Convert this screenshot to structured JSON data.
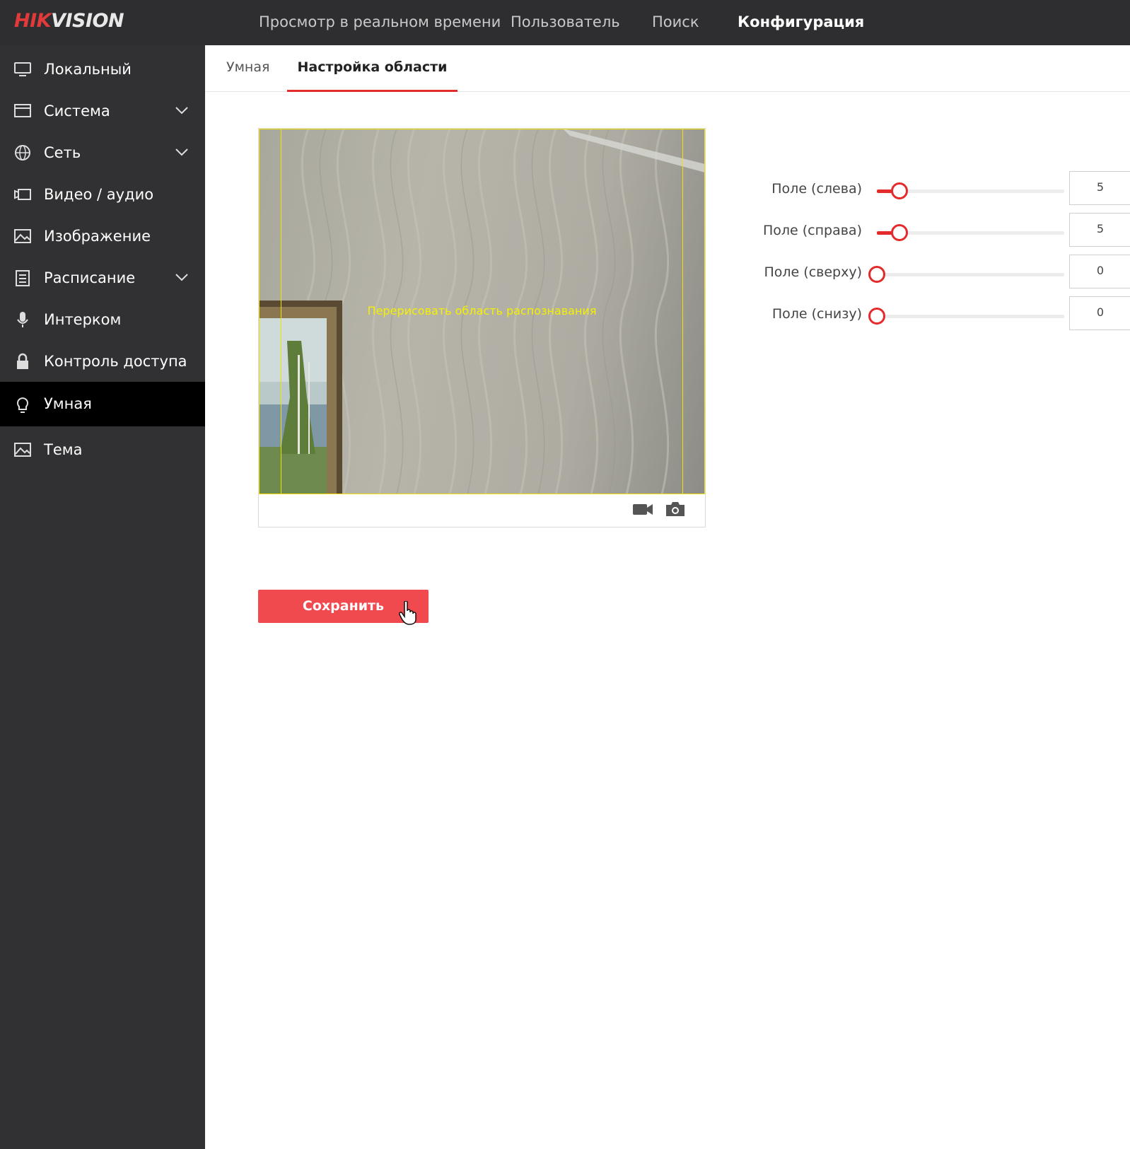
{
  "brand": {
    "part1": "HIK",
    "part2": "VISION"
  },
  "header": {
    "nav": [
      {
        "label": "Просмотр в реальном времени",
        "active": false
      },
      {
        "label": "Пользователь",
        "active": false
      },
      {
        "label": "Поиск",
        "active": false
      },
      {
        "label": "Конфигурация",
        "active": true
      }
    ]
  },
  "sidebar": {
    "items": [
      {
        "label": "Локальный",
        "icon": "monitor-icon",
        "expandable": false
      },
      {
        "label": "Система",
        "icon": "window-icon",
        "expandable": true
      },
      {
        "label": "Сеть",
        "icon": "globe-icon",
        "expandable": true
      },
      {
        "label": "Видео / аудио",
        "icon": "video-icon",
        "expandable": false
      },
      {
        "label": "Изображение",
        "icon": "image-icon",
        "expandable": false
      },
      {
        "label": "Расписание",
        "icon": "schedule-icon",
        "expandable": true
      },
      {
        "label": "Интерком",
        "icon": "microphone-icon",
        "expandable": false
      },
      {
        "label": "Контроль доступа",
        "icon": "lock-icon",
        "expandable": false
      },
      {
        "label": "Умная",
        "icon": "bulb-icon",
        "expandable": false,
        "active": true
      },
      {
        "label": "Тема",
        "icon": "theme-icon",
        "expandable": false
      }
    ]
  },
  "tabs": [
    {
      "label": "Умная",
      "active": false
    },
    {
      "label": "Настройка области",
      "active": true
    }
  ],
  "preview": {
    "overlay_text": "Перерисовать область распознавания"
  },
  "fields": [
    {
      "label": "Поле (слева)",
      "value": "5",
      "fraction": 0.05
    },
    {
      "label": "Поле (справа)",
      "value": "5",
      "fraction": 0.05
    },
    {
      "label": "Поле (сверху)",
      "value": "0",
      "fraction": 0.0
    },
    {
      "label": "Поле (снизу)",
      "value": "0",
      "fraction": 0.0
    }
  ],
  "save_label": "Сохранить",
  "colors": {
    "accent": "#e32b2b",
    "topbar": "#2e2e30",
    "sidebar": "#313133",
    "roi": "#f2e200"
  }
}
